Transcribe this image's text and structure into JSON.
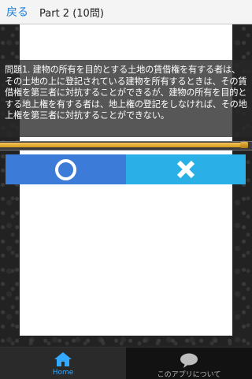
{
  "header": {
    "back_label": "戻る",
    "title": "Part 2 (10問)"
  },
  "question": {
    "text": "問題1. 建物の所有を目的とする土地の賃借権を有する者は、その土地の上に登記されている建物を所有するときは、その賃借権を第三者に対抗することができるが、建物の所有を目的とする地上権を有する者は、地上権の登記をしなければ、その地上権を第三者に対抗することができない。"
  },
  "progress": {
    "fraction": 0.97
  },
  "answers": {
    "maru_icon": "circle-icon",
    "batsu_icon": "cross-icon"
  },
  "nav": {
    "home_label": "Home",
    "about_label": "このアプリについて",
    "home_icon": "home-icon",
    "about_icon": "speech-bubble-icon"
  },
  "colors": {
    "accent_blue": "#3c7bd8",
    "accent_cyan": "#2ab0e6",
    "progress_gold": "#e0a830",
    "nav_active": "#33aaff"
  }
}
